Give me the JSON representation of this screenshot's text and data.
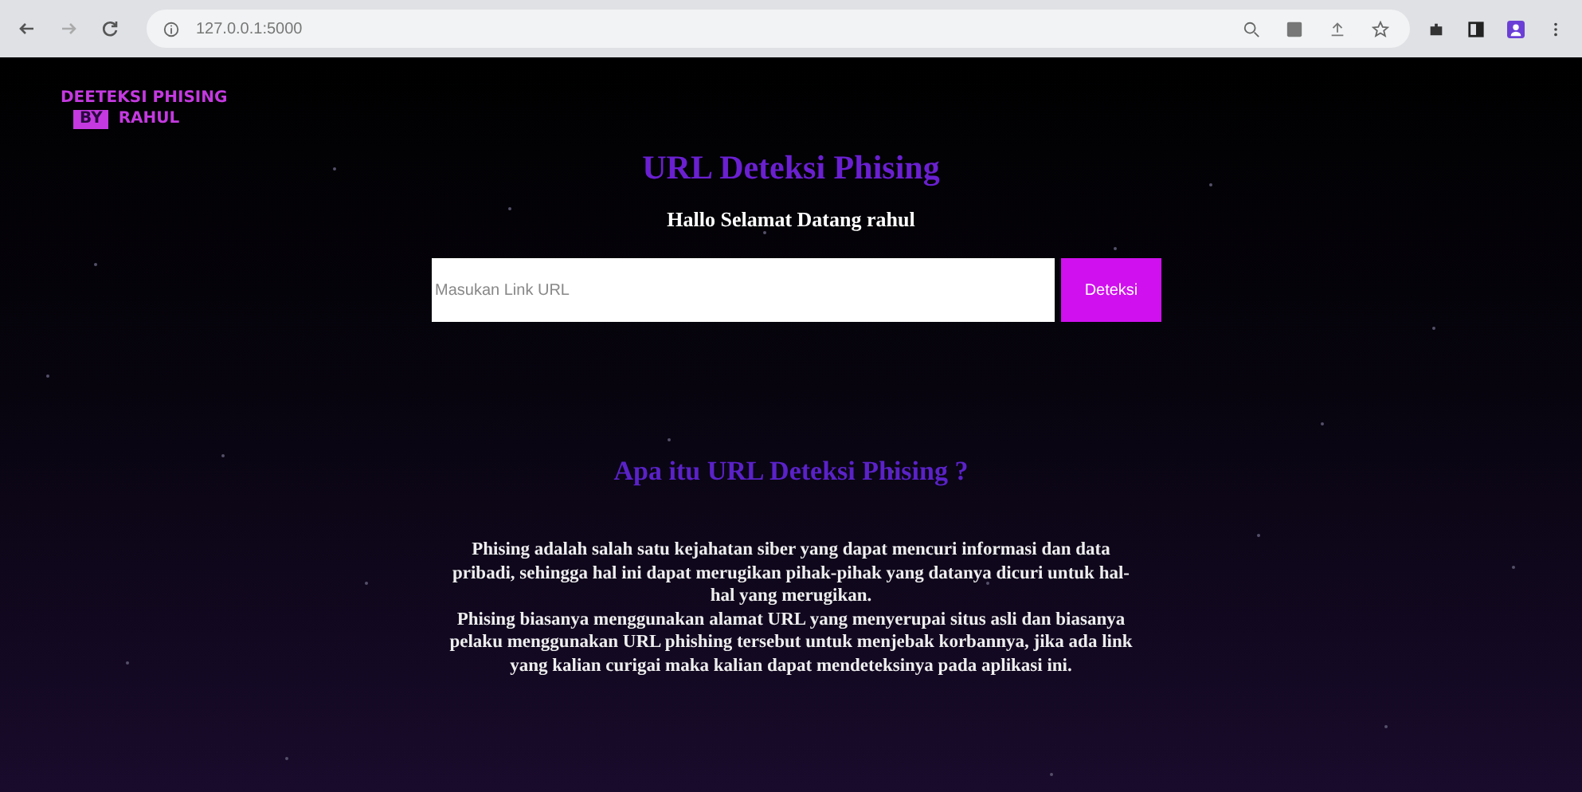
{
  "browser": {
    "url": "127.0.0.1:5000"
  },
  "logo": {
    "line1": "DEETEKSI PHISING",
    "tag": "BY",
    "name": "RAHUL"
  },
  "hero": {
    "title": "URL Deteksi Phising",
    "greeting": "Hallo Selamat Datang rahul",
    "input": {
      "placeholder": "Masukan Link URL"
    },
    "button": "Deteksi"
  },
  "about": {
    "heading": "Apa itu URL Deteksi Phising ?",
    "paragraphs": [
      "Phising adalah salah satu kejahatan siber yang dapat mencuri informasi dan data pribadi, sehingga hal ini dapat merugikan pihak-pihak yang datanya dicuri untuk hal-hal yang merugikan.",
      "Phising biasanya menggunakan alamat URL yang menyerupai situs asli dan biasanya pelaku menggunakan URL phishing tersebut untuk menjebak korbannya, jika ada link yang kalian curigai maka kalian dapat mendeteksinya pada aplikasi ini."
    ]
  }
}
